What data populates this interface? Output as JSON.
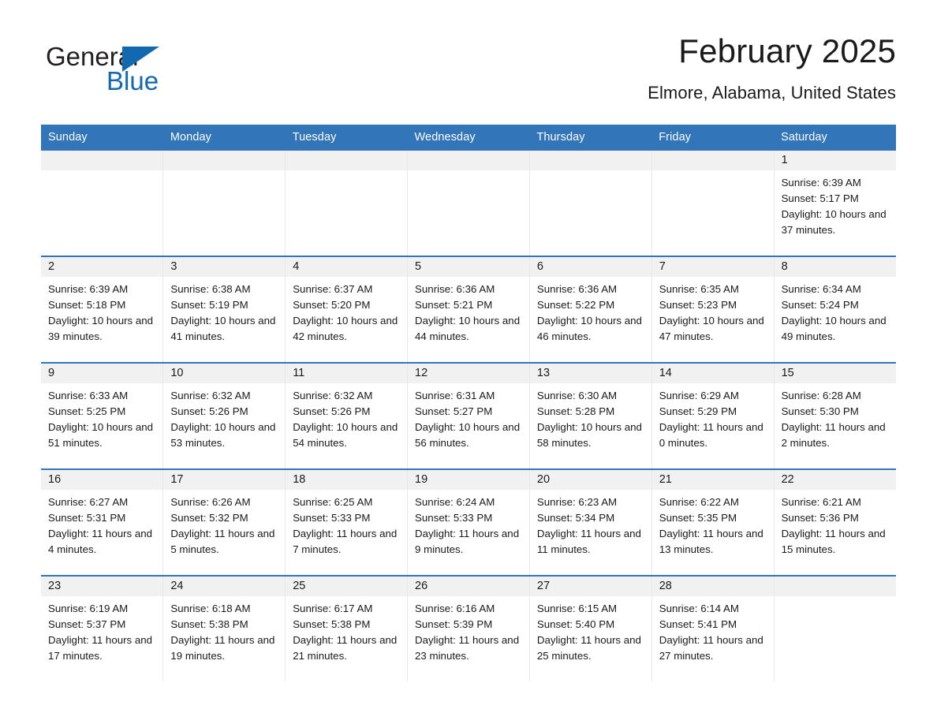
{
  "brand": {
    "name_part1": "General",
    "name_part2": "Blue",
    "accent_color": "#1269b0"
  },
  "header": {
    "title": "February 2025",
    "location": "Elmore, Alabama, United States"
  },
  "calendar": {
    "header_bg": "#3275b8",
    "daynum_bg": "#f1f1f1",
    "weekday_headers": [
      "Sunday",
      "Monday",
      "Tuesday",
      "Wednesday",
      "Thursday",
      "Friday",
      "Saturday"
    ],
    "weeks": [
      [
        {
          "day": "",
          "sunrise": "",
          "sunset": "",
          "daylight": ""
        },
        {
          "day": "",
          "sunrise": "",
          "sunset": "",
          "daylight": ""
        },
        {
          "day": "",
          "sunrise": "",
          "sunset": "",
          "daylight": ""
        },
        {
          "day": "",
          "sunrise": "",
          "sunset": "",
          "daylight": ""
        },
        {
          "day": "",
          "sunrise": "",
          "sunset": "",
          "daylight": ""
        },
        {
          "day": "",
          "sunrise": "",
          "sunset": "",
          "daylight": ""
        },
        {
          "day": "1",
          "sunrise": "Sunrise: 6:39 AM",
          "sunset": "Sunset: 5:17 PM",
          "daylight": "Daylight: 10 hours and 37 minutes."
        }
      ],
      [
        {
          "day": "2",
          "sunrise": "Sunrise: 6:39 AM",
          "sunset": "Sunset: 5:18 PM",
          "daylight": "Daylight: 10 hours and 39 minutes."
        },
        {
          "day": "3",
          "sunrise": "Sunrise: 6:38 AM",
          "sunset": "Sunset: 5:19 PM",
          "daylight": "Daylight: 10 hours and 41 minutes."
        },
        {
          "day": "4",
          "sunrise": "Sunrise: 6:37 AM",
          "sunset": "Sunset: 5:20 PM",
          "daylight": "Daylight: 10 hours and 42 minutes."
        },
        {
          "day": "5",
          "sunrise": "Sunrise: 6:36 AM",
          "sunset": "Sunset: 5:21 PM",
          "daylight": "Daylight: 10 hours and 44 minutes."
        },
        {
          "day": "6",
          "sunrise": "Sunrise: 6:36 AM",
          "sunset": "Sunset: 5:22 PM",
          "daylight": "Daylight: 10 hours and 46 minutes."
        },
        {
          "day": "7",
          "sunrise": "Sunrise: 6:35 AM",
          "sunset": "Sunset: 5:23 PM",
          "daylight": "Daylight: 10 hours and 47 minutes."
        },
        {
          "day": "8",
          "sunrise": "Sunrise: 6:34 AM",
          "sunset": "Sunset: 5:24 PM",
          "daylight": "Daylight: 10 hours and 49 minutes."
        }
      ],
      [
        {
          "day": "9",
          "sunrise": "Sunrise: 6:33 AM",
          "sunset": "Sunset: 5:25 PM",
          "daylight": "Daylight: 10 hours and 51 minutes."
        },
        {
          "day": "10",
          "sunrise": "Sunrise: 6:32 AM",
          "sunset": "Sunset: 5:26 PM",
          "daylight": "Daylight: 10 hours and 53 minutes."
        },
        {
          "day": "11",
          "sunrise": "Sunrise: 6:32 AM",
          "sunset": "Sunset: 5:26 PM",
          "daylight": "Daylight: 10 hours and 54 minutes."
        },
        {
          "day": "12",
          "sunrise": "Sunrise: 6:31 AM",
          "sunset": "Sunset: 5:27 PM",
          "daylight": "Daylight: 10 hours and 56 minutes."
        },
        {
          "day": "13",
          "sunrise": "Sunrise: 6:30 AM",
          "sunset": "Sunset: 5:28 PM",
          "daylight": "Daylight: 10 hours and 58 minutes."
        },
        {
          "day": "14",
          "sunrise": "Sunrise: 6:29 AM",
          "sunset": "Sunset: 5:29 PM",
          "daylight": "Daylight: 11 hours and 0 minutes."
        },
        {
          "day": "15",
          "sunrise": "Sunrise: 6:28 AM",
          "sunset": "Sunset: 5:30 PM",
          "daylight": "Daylight: 11 hours and 2 minutes."
        }
      ],
      [
        {
          "day": "16",
          "sunrise": "Sunrise: 6:27 AM",
          "sunset": "Sunset: 5:31 PM",
          "daylight": "Daylight: 11 hours and 4 minutes."
        },
        {
          "day": "17",
          "sunrise": "Sunrise: 6:26 AM",
          "sunset": "Sunset: 5:32 PM",
          "daylight": "Daylight: 11 hours and 5 minutes."
        },
        {
          "day": "18",
          "sunrise": "Sunrise: 6:25 AM",
          "sunset": "Sunset: 5:33 PM",
          "daylight": "Daylight: 11 hours and 7 minutes."
        },
        {
          "day": "19",
          "sunrise": "Sunrise: 6:24 AM",
          "sunset": "Sunset: 5:33 PM",
          "daylight": "Daylight: 11 hours and 9 minutes."
        },
        {
          "day": "20",
          "sunrise": "Sunrise: 6:23 AM",
          "sunset": "Sunset: 5:34 PM",
          "daylight": "Daylight: 11 hours and 11 minutes."
        },
        {
          "day": "21",
          "sunrise": "Sunrise: 6:22 AM",
          "sunset": "Sunset: 5:35 PM",
          "daylight": "Daylight: 11 hours and 13 minutes."
        },
        {
          "day": "22",
          "sunrise": "Sunrise: 6:21 AM",
          "sunset": "Sunset: 5:36 PM",
          "daylight": "Daylight: 11 hours and 15 minutes."
        }
      ],
      [
        {
          "day": "23",
          "sunrise": "Sunrise: 6:19 AM",
          "sunset": "Sunset: 5:37 PM",
          "daylight": "Daylight: 11 hours and 17 minutes."
        },
        {
          "day": "24",
          "sunrise": "Sunrise: 6:18 AM",
          "sunset": "Sunset: 5:38 PM",
          "daylight": "Daylight: 11 hours and 19 minutes."
        },
        {
          "day": "25",
          "sunrise": "Sunrise: 6:17 AM",
          "sunset": "Sunset: 5:38 PM",
          "daylight": "Daylight: 11 hours and 21 minutes."
        },
        {
          "day": "26",
          "sunrise": "Sunrise: 6:16 AM",
          "sunset": "Sunset: 5:39 PM",
          "daylight": "Daylight: 11 hours and 23 minutes."
        },
        {
          "day": "27",
          "sunrise": "Sunrise: 6:15 AM",
          "sunset": "Sunset: 5:40 PM",
          "daylight": "Daylight: 11 hours and 25 minutes."
        },
        {
          "day": "28",
          "sunrise": "Sunrise: 6:14 AM",
          "sunset": "Sunset: 5:41 PM",
          "daylight": "Daylight: 11 hours and 27 minutes."
        },
        {
          "day": "",
          "sunrise": "",
          "sunset": "",
          "daylight": ""
        }
      ]
    ]
  }
}
